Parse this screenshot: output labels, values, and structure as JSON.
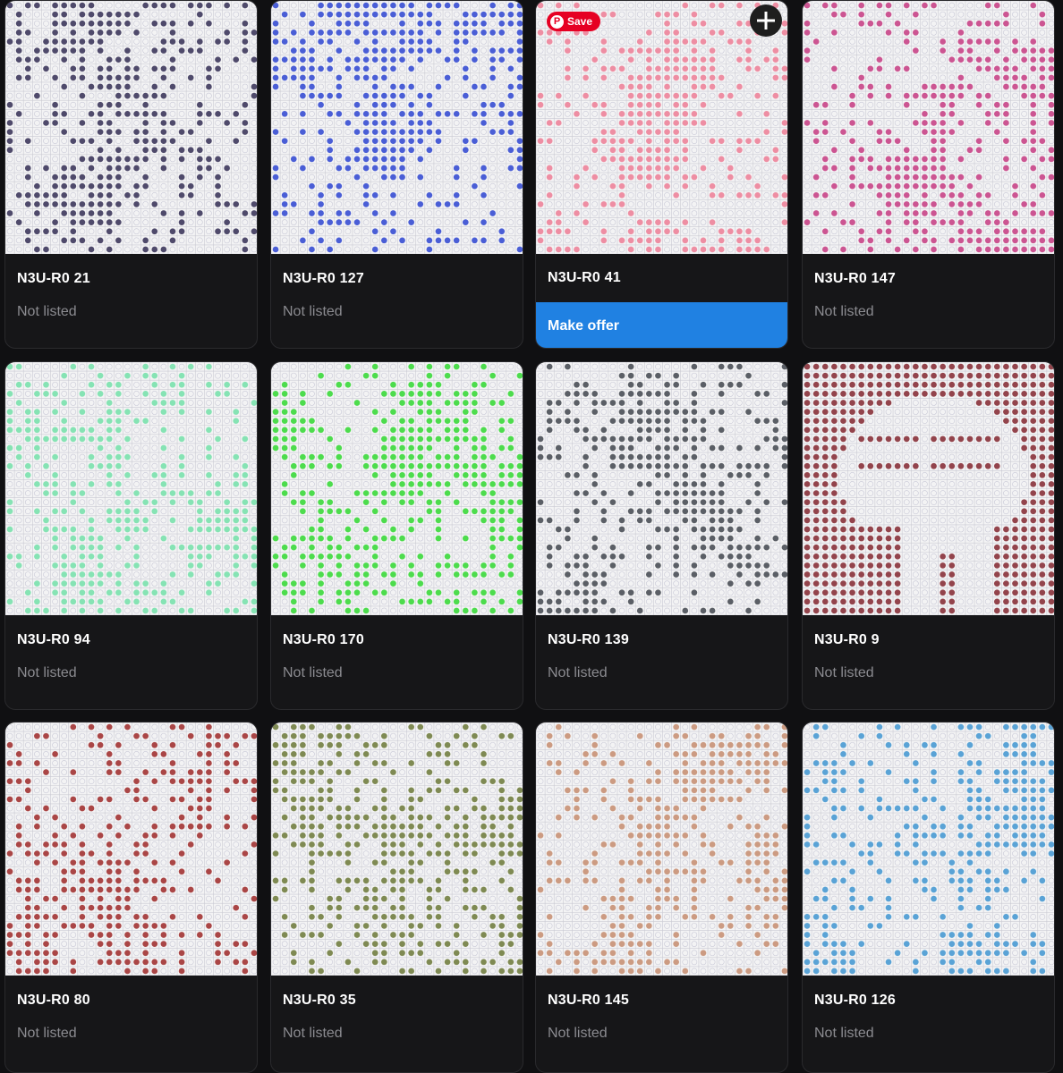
{
  "items": [
    {
      "name": "N3U-R0 21",
      "status": "Not listed",
      "color": "#4f4a6b"
    },
    {
      "name": "N3U-R0 127",
      "status": "Not listed",
      "color": "#4a5ed6"
    },
    {
      "name": "N3U-R0 41",
      "status": "",
      "color": "#ee8ea3",
      "action": "Make offer",
      "save_label": "Save",
      "pin_glyph": "P"
    },
    {
      "name": "N3U-R0 147",
      "status": "Not listed",
      "color": "#cc5592"
    },
    {
      "name": "N3U-R0 94",
      "status": "Not listed",
      "color": "#86e3b4"
    },
    {
      "name": "N3U-R0 170",
      "status": "Not listed",
      "color": "#4ddc4d"
    },
    {
      "name": "N3U-R0 139",
      "status": "Not listed",
      "color": "#5b5f66"
    },
    {
      "name": "N3U-R0 9",
      "status": "Not listed",
      "color": "#93444c"
    },
    {
      "name": "N3U-R0 80",
      "status": "Not listed",
      "color": "#aa4646"
    },
    {
      "name": "N3U-R0 35",
      "status": "Not listed",
      "color": "#7f8a53"
    },
    {
      "name": "N3U-R0 145",
      "status": "Not listed",
      "color": "#cc9b82"
    },
    {
      "name": "N3U-R0 126",
      "status": "Not listed",
      "color": "#5aa3d6"
    }
  ]
}
